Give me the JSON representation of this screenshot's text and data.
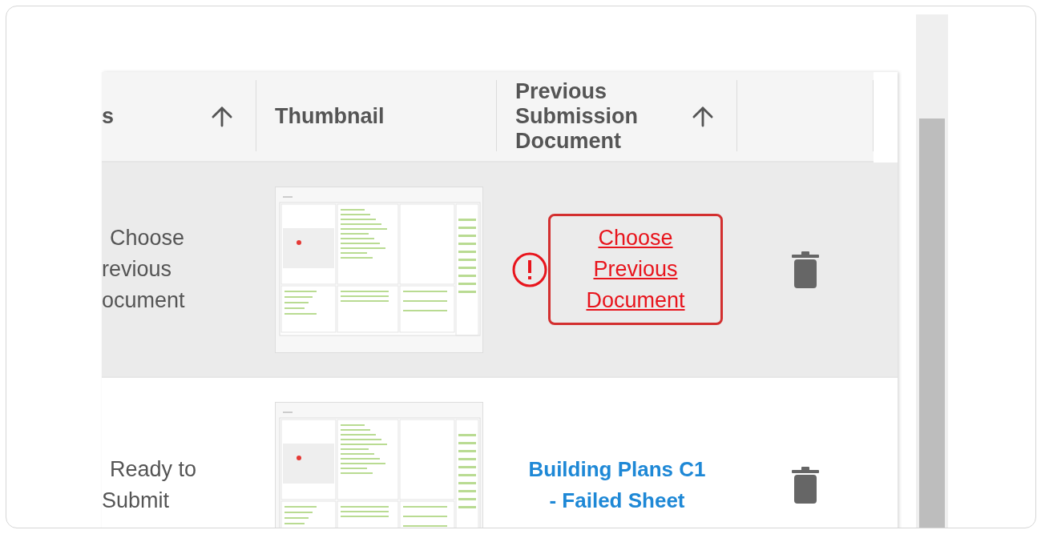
{
  "table": {
    "columns": [
      {
        "label": "s",
        "sortable": true
      },
      {
        "label": "Thumbnail",
        "sortable": false
      },
      {
        "label": "Previous Submission Document",
        "sortable": true
      }
    ],
    "rows": [
      {
        "selected": true,
        "status_lines": [
          "Choose",
          "revious",
          "ocument"
        ],
        "document": {
          "kind": "missing",
          "text": "Choose Previous Document"
        }
      },
      {
        "selected": false,
        "status_lines": [
          "Ready to",
          "Submit"
        ],
        "document": {
          "kind": "link",
          "text": "Building Plans C1 - Failed Sheet"
        }
      }
    ]
  }
}
